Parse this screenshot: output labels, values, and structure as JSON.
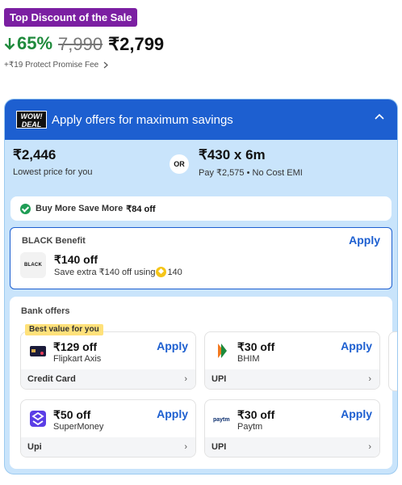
{
  "badge": "Top Discount of the Sale",
  "price": {
    "discount": "65%",
    "mrp": "7,990",
    "final": "₹2,799"
  },
  "fee": "+₹19 Protect Promise Fee",
  "offers": {
    "title": "Apply offers for maximum savings",
    "wow_line1": "WOW!",
    "wow_line2": "DEAL",
    "lowest": {
      "value": "₹2,446",
      "label": "Lowest price for you"
    },
    "or": "OR",
    "emi": {
      "value": "₹430 x 6m",
      "label": "Pay ₹2,575 • No Cost EMI"
    },
    "bmsm": {
      "label": "Buy More Save More",
      "amount": "₹84 off"
    },
    "black": {
      "title": "BLACK Benefit",
      "apply": "Apply",
      "logo": "BLACK",
      "amount": "₹140 off",
      "sub_prefix": "Save extra ₹140 off using",
      "coins": "140"
    },
    "bank": {
      "title": "Bank offers",
      "best_tag": "Best value for you",
      "cards": [
        {
          "amount": "₹129 off",
          "name": "Flipkart Axis",
          "apply": "Apply",
          "footer": "Credit Card",
          "icon": "credit-card-icon"
        },
        {
          "amount": "₹30 off",
          "name": "BHIM",
          "apply": "Apply",
          "footer": "UPI",
          "icon": "bhim-logo-icon"
        },
        {
          "amount": "₹50 off",
          "name": "SuperMoney",
          "apply": "Apply",
          "footer": "Upi",
          "icon": "supermoney-logo-icon"
        },
        {
          "amount": "₹30 off",
          "name": "Paytm",
          "apply": "Apply",
          "footer": "UPI",
          "icon": "paytm-logo-icon",
          "logo_text": "paytm"
        }
      ]
    }
  },
  "colors": {
    "accent": "#1d5fd0",
    "discount": "#1f8a3c",
    "badge": "#7b1fa2",
    "panel": "#c9e4fb"
  }
}
